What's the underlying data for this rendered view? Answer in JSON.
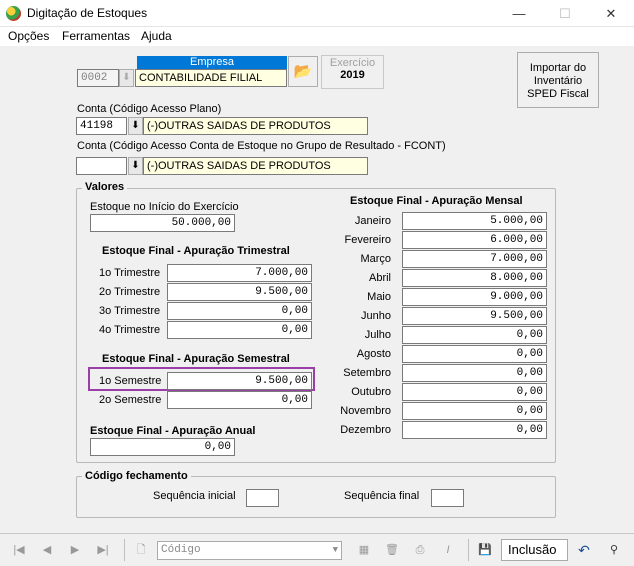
{
  "window": {
    "title": "Digitação de Estoques",
    "min": "—",
    "max": "☐",
    "close": "✕"
  },
  "menu": [
    {
      "label": "Opções"
    },
    {
      "label": "Ferramentas"
    },
    {
      "label": "Ajuda"
    }
  ],
  "empresa": {
    "label": "Empresa",
    "code": "0002",
    "name": "CONTABILIDADE FILIAL"
  },
  "exercicio": {
    "label": "Exercício",
    "value": "2019"
  },
  "import_button": {
    "line1": "Importar do",
    "line2": "Inventário",
    "line3": "SPED Fiscal"
  },
  "conta": {
    "label": "Conta (Código Acesso Plano)",
    "code": "41198",
    "name": "(-)OUTRAS SAIDAS DE PRODUTOS"
  },
  "conta_fcont": {
    "label": "Conta (Código Acesso Conta de Estoque no Grupo de Resultado - FCONT)",
    "code": "",
    "name": "(-)OUTRAS SAIDAS DE PRODUTOS"
  },
  "valores": {
    "legend": "Valores",
    "inicio": {
      "label": "Estoque no Início do Exercício",
      "value": "50.000,00"
    },
    "trimestral": {
      "title": "Estoque Final - Apuração Trimestral",
      "rows": [
        {
          "label": "1o Trimestre",
          "value": "7.000,00"
        },
        {
          "label": "2o Trimestre",
          "value": "9.500,00"
        },
        {
          "label": "3o Trimestre",
          "value": "0,00"
        },
        {
          "label": "4o Trimestre",
          "value": "0,00"
        }
      ]
    },
    "semestral": {
      "title": "Estoque Final - Apuração Semestral",
      "rows": [
        {
          "label": "1o Semestre",
          "value": "9.500,00"
        },
        {
          "label": "2o Semestre",
          "value": "0,00"
        }
      ]
    },
    "anual": {
      "title": "Estoque Final - Apuração Anual",
      "value": "0,00"
    },
    "mensal": {
      "title": "Estoque Final - Apuração Mensal",
      "rows": [
        {
          "label": "Janeiro",
          "value": "5.000,00"
        },
        {
          "label": "Fevereiro",
          "value": "6.000,00"
        },
        {
          "label": "Março",
          "value": "7.000,00"
        },
        {
          "label": "Abril",
          "value": "8.000,00"
        },
        {
          "label": "Maio",
          "value": "9.000,00"
        },
        {
          "label": "Junho",
          "value": "9.500,00"
        },
        {
          "label": "Julho",
          "value": "0,00"
        },
        {
          "label": "Agosto",
          "value": "0,00"
        },
        {
          "label": "Setembro",
          "value": "0,00"
        },
        {
          "label": "Outubro",
          "value": "0,00"
        },
        {
          "label": "Novembro",
          "value": "0,00"
        },
        {
          "label": "Dezembro",
          "value": "0,00"
        }
      ]
    }
  },
  "fechamento": {
    "legend": "Código fechamento",
    "inicial_label": "Sequência inicial",
    "final_label": "Sequência final",
    "inicial": "",
    "final": ""
  },
  "toolbar": {
    "codigo_placeholder": "Código",
    "mode": "Inclusão"
  },
  "colors": {
    "highlight": "#9b3fa8",
    "empresa_header": "#0078d7"
  }
}
